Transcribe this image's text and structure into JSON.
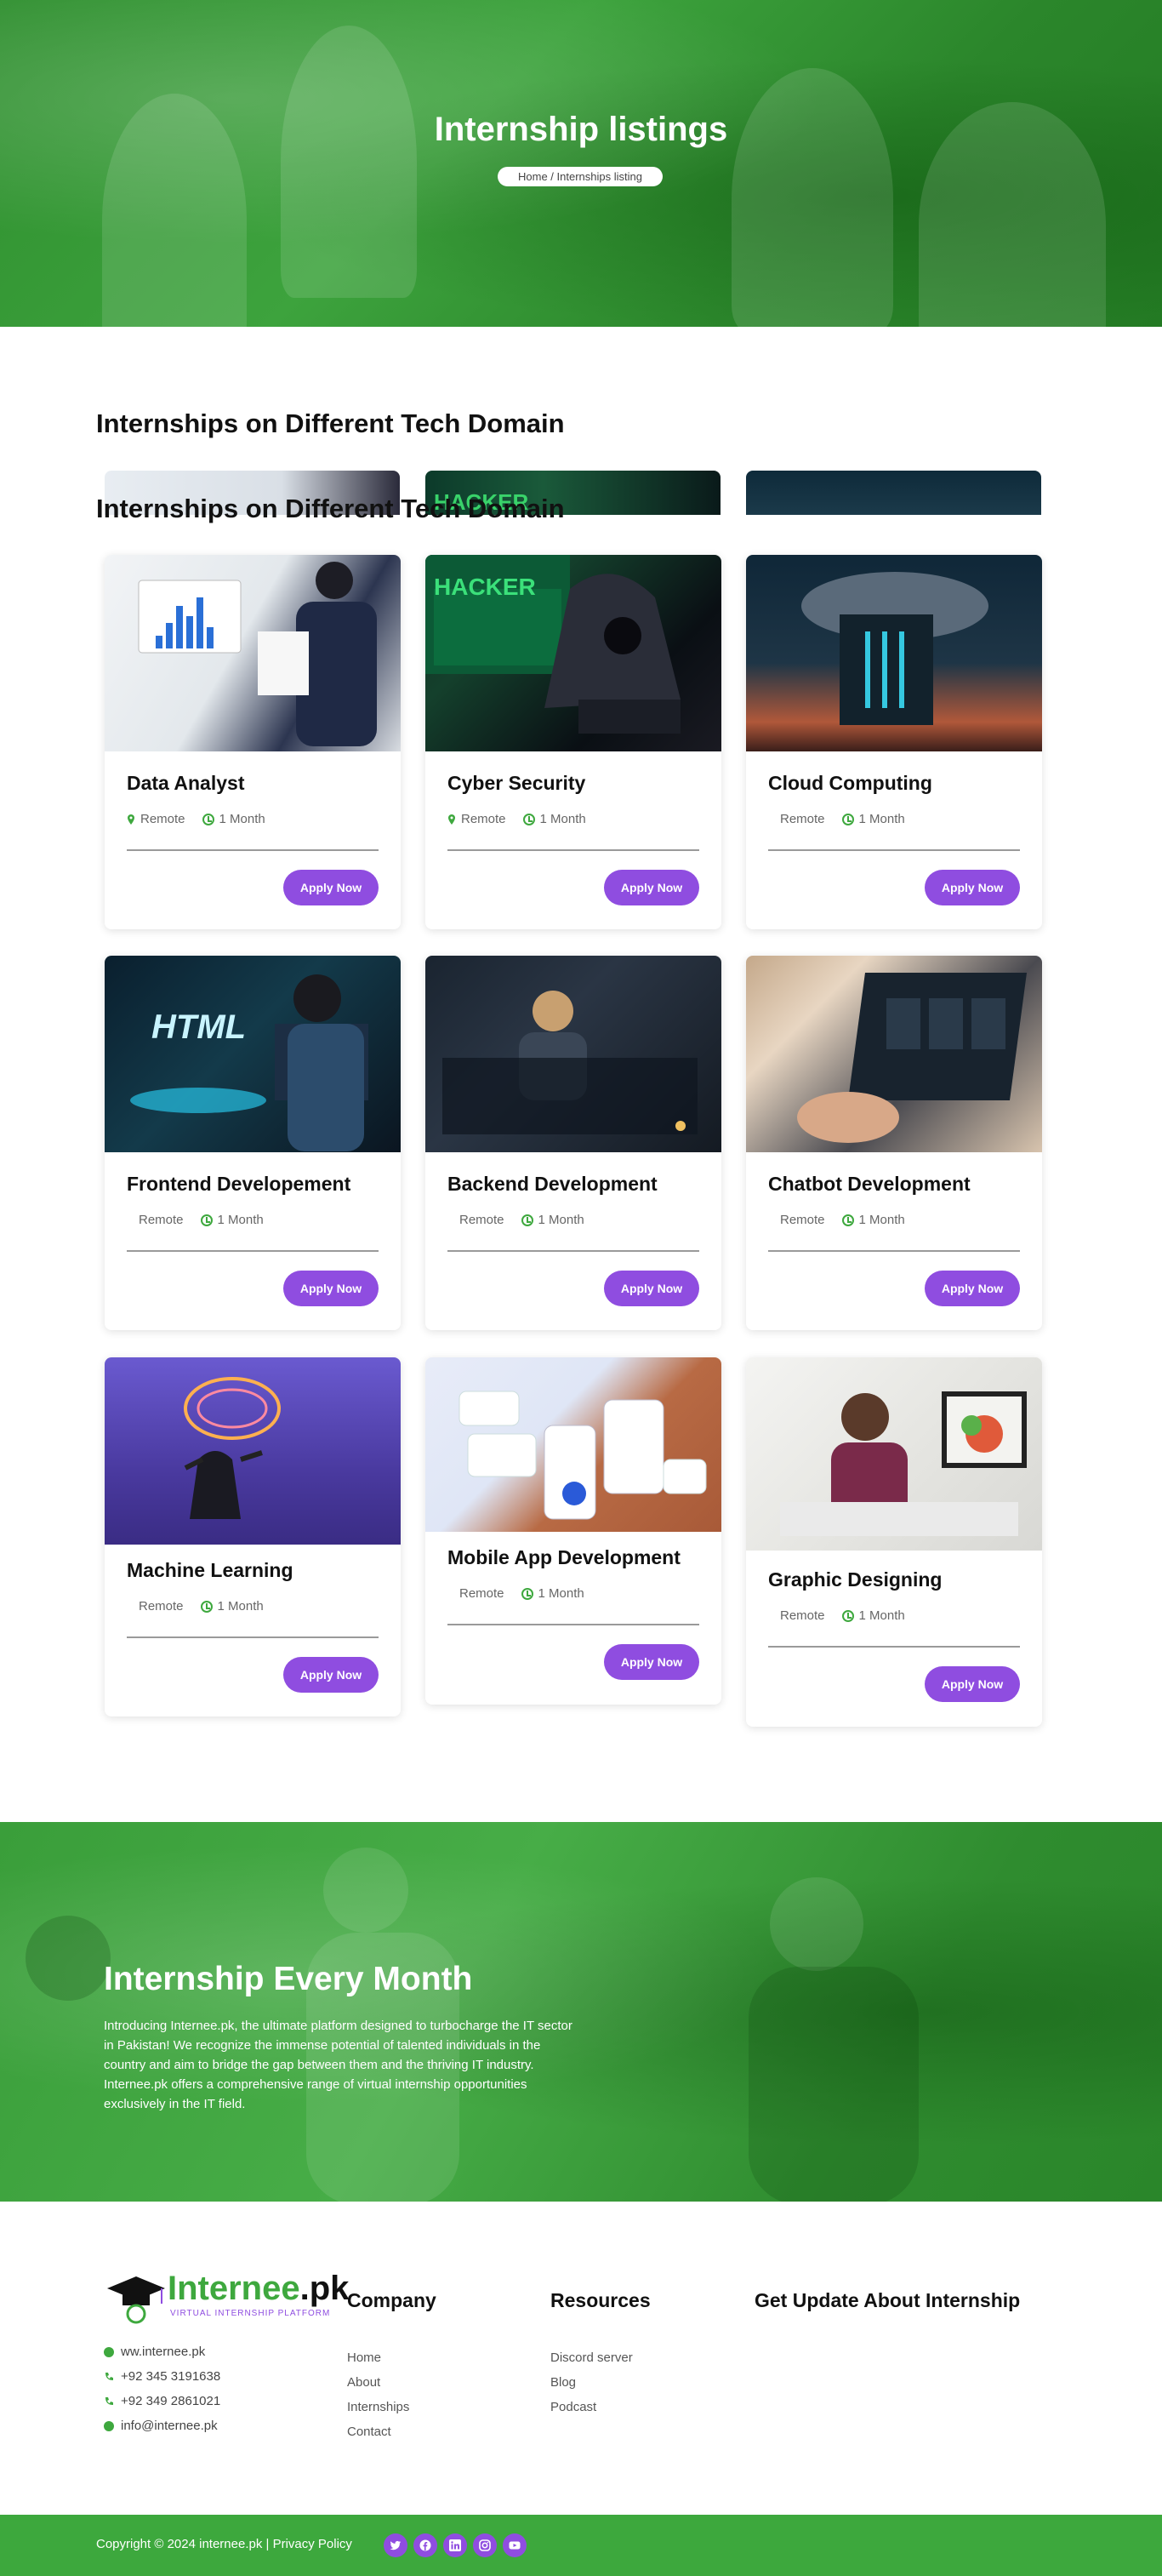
{
  "hero": {
    "title": "Internship listings",
    "breadcrumb": "Home / Internships listing"
  },
  "section": {
    "title": "Internships on Different Tech Domain"
  },
  "cards": [
    {
      "title": "Data Analyst",
      "location": "Remote",
      "duration": "1 Month",
      "button": "Apply Now"
    },
    {
      "title": "Cyber Security",
      "location": "Remote",
      "duration": "1 Month",
      "button": "Apply Now"
    },
    {
      "title": "Cloud Computing",
      "location": "Remote",
      "duration": "1 Month",
      "button": "Apply Now"
    },
    {
      "title": "Frontend Developement",
      "location": "Remote",
      "duration": "1 Month",
      "button": "Apply Now"
    },
    {
      "title": "Backend Development",
      "location": "Remote",
      "duration": "1 Month",
      "button": "Apply Now"
    },
    {
      "title": "Chatbot Development",
      "location": "Remote",
      "duration": "1 Month",
      "button": "Apply Now"
    },
    {
      "title": "Machine Learning",
      "location": "Remote",
      "duration": "1 Month",
      "button": "Apply Now"
    },
    {
      "title": "Mobile App Development",
      "location": "Remote",
      "duration": "1 Month",
      "button": "Apply Now"
    },
    {
      "title": "Graphic Designing",
      "location": "Remote",
      "duration": "1 Month",
      "button": "Apply Now"
    }
  ],
  "image_text": {
    "hacker": "HACKER",
    "html": "HTML"
  },
  "banner": {
    "title": "Internship Every Month",
    "text": "Introducing Internee.pk, the ultimate platform designed to turbocharge the IT sector in Pakistan! We recognize the immense potential of talented individuals in the country and aim to bridge the gap between them and the thriving IT industry. Internee.pk offers a comprehensive range of virtual internship opportunities exclusively in the IT field."
  },
  "footer": {
    "logo_word": "Internee",
    "logo_suffix": ".pk",
    "logo_tagline": "VIRTUAL INTERNSHIP PLATFORM",
    "contacts": [
      {
        "icon": "globe-icon",
        "text": "ww.internee.pk"
      },
      {
        "icon": "phone-icon",
        "text": "+92 345 3191638"
      },
      {
        "icon": "phone-icon",
        "text": "+92 349 2861021"
      },
      {
        "icon": "globe-icon",
        "text": "info@internee.pk"
      }
    ],
    "company_title": "Company",
    "company_links": [
      "Home",
      "About",
      "Internships",
      "Contact"
    ],
    "resources_title": "Resources",
    "resources_links": [
      "Discord server",
      "Blog",
      "Podcast"
    ],
    "update_title": "Get Update About Internship",
    "copyright": "Copyright © 2024 internee.pk | Privacy Policy",
    "social": [
      "twitter-icon",
      "facebook-icon",
      "linkedin-icon",
      "instagram-icon",
      "youtube-icon"
    ]
  },
  "colors": {
    "brand_green": "#3ea83e",
    "accent_purple": "#8f4de0"
  }
}
